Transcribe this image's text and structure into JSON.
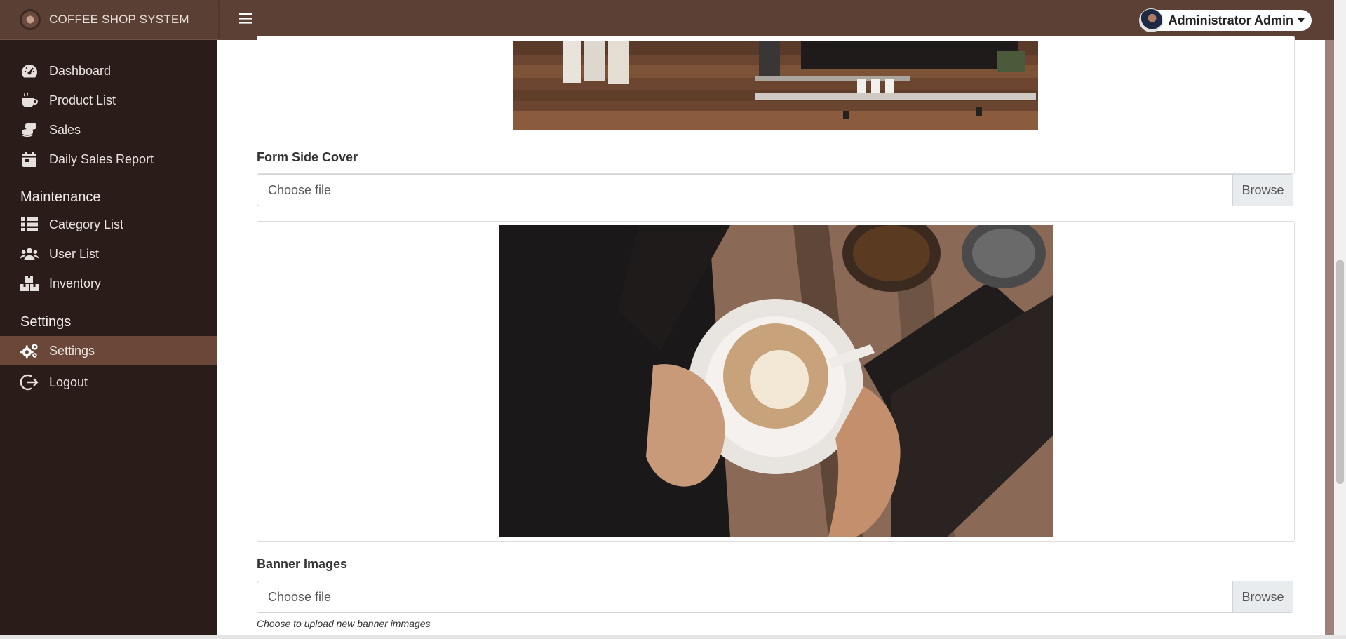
{
  "app": {
    "brand_title": "COFFEE SHOP SYSTEM"
  },
  "header": {
    "user_name": "Administrator Admin"
  },
  "sidebar": {
    "items": [
      {
        "label": "Dashboard",
        "icon": "tachometer-icon"
      },
      {
        "label": "Product List",
        "icon": "coffee-icon"
      },
      {
        "label": "Sales",
        "icon": "coins-icon"
      },
      {
        "label": "Daily Sales Report",
        "icon": "calendar-icon"
      }
    ],
    "maintenance_header": "Maintenance",
    "maintenance_items": [
      {
        "label": "Category List",
        "icon": "list-icon"
      },
      {
        "label": "User List",
        "icon": "users-icon"
      },
      {
        "label": "Inventory",
        "icon": "boxes-icon"
      }
    ],
    "settings_header": "Settings",
    "settings_items": [
      {
        "label": "Settings",
        "icon": "gears-icon",
        "active": true
      },
      {
        "label": "Logout",
        "icon": "logout-icon"
      }
    ]
  },
  "form": {
    "side_cover": {
      "label": "Form Side Cover",
      "placeholder": "Choose file",
      "browse_label": "Browse"
    },
    "banner": {
      "label": "Banner Images",
      "placeholder": "Choose file",
      "browse_label": "Browse",
      "hint": "Choose to upload new banner immages"
    }
  },
  "colors": {
    "sidebar_bg": "#2a1c18",
    "topbar_bg": "#5c4035",
    "active_item": "#6a4738",
    "page_bg": "#9e8178"
  }
}
